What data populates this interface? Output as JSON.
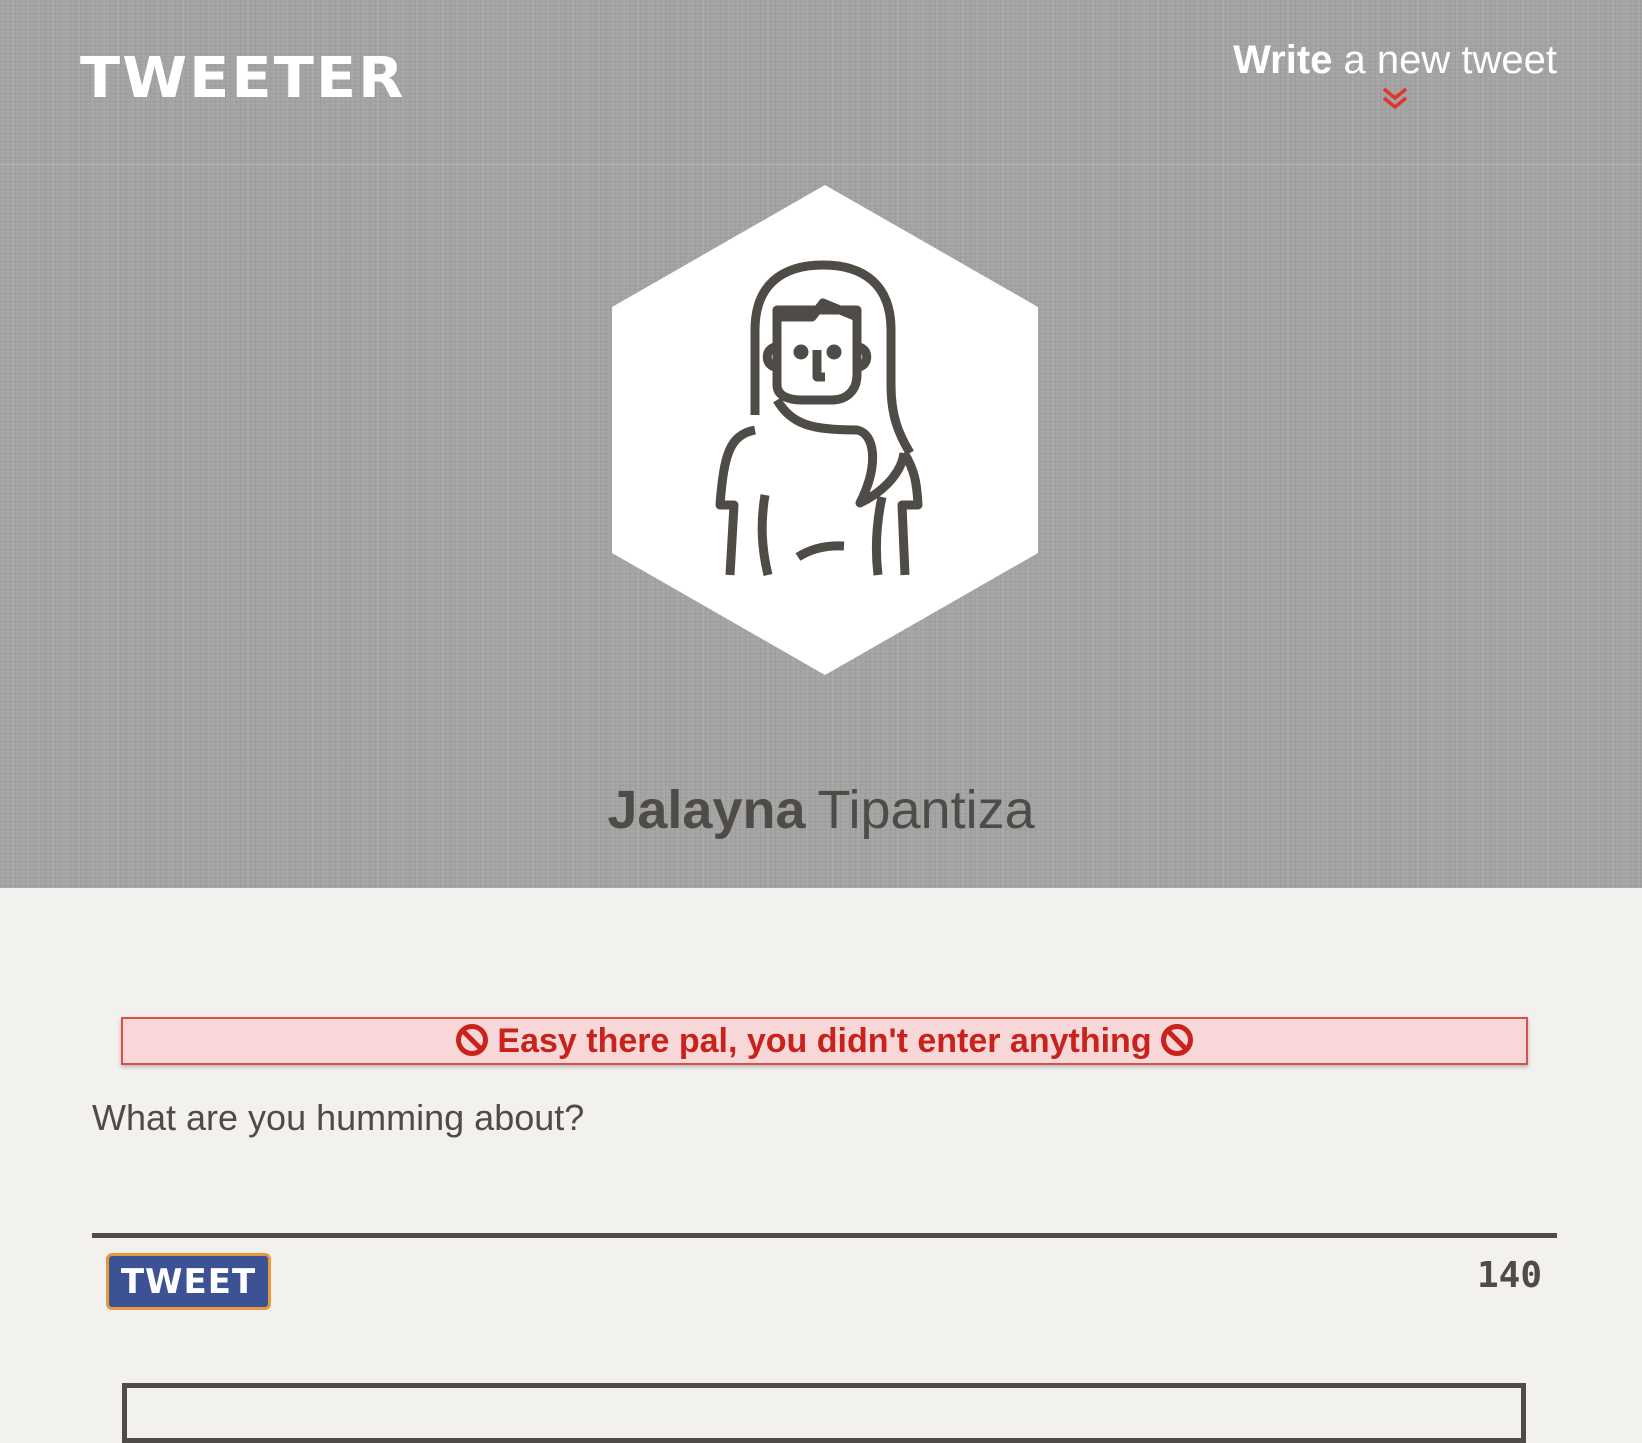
{
  "app": {
    "logo_text": "TWEETER"
  },
  "nav": {
    "compose_strong": "Write",
    "compose_rest": "a new tweet",
    "compose_icon": "double-chevron-down-icon",
    "accent_color": "#e0342d"
  },
  "profile": {
    "avatar_icon": "woman-avatar-icon",
    "first_name": "Jalayna",
    "last_name": "Tipantiza"
  },
  "composer": {
    "error_message": "Easy there pal, you didn't enter anything",
    "error_icon": "no-entry-icon",
    "placeholder": "What are you humming about?",
    "value": "",
    "button_label": "TWEET",
    "char_count": "140",
    "button_color": "#3d5294",
    "button_border_color": "#e49a3c",
    "error_color": "#c8221b"
  }
}
